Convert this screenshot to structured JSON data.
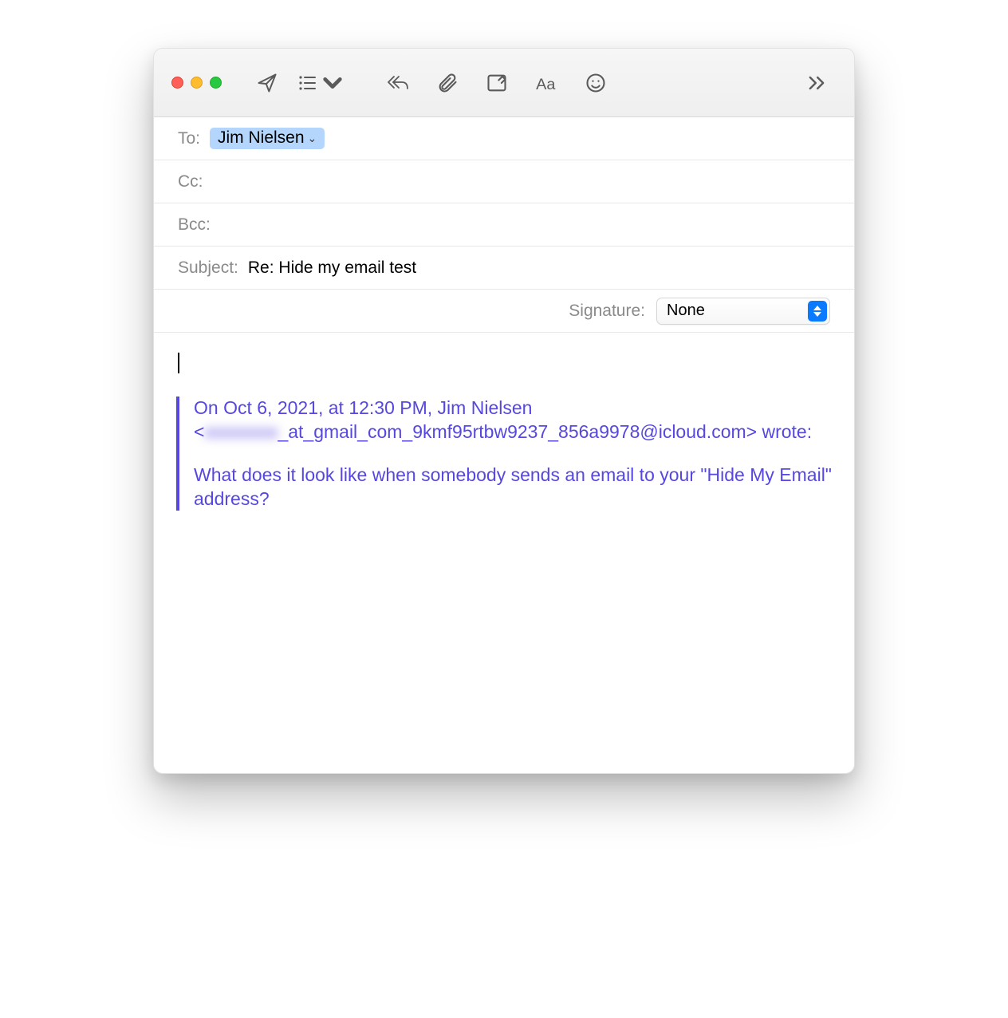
{
  "compose": {
    "to_label": "To:",
    "cc_label": "Cc:",
    "bcc_label": "Bcc:",
    "subject_label": "Subject:",
    "subject_value": "Re: Hide my email test",
    "recipient": "Jim Nielsen",
    "signature_label": "Signature:",
    "signature_value": "None"
  },
  "quoted": {
    "line1_prefix": "On Oct 6, 2021, at 12:30 PM, Jim Nielsen <",
    "hidden_user": "xxxxxxxx",
    "line1_suffix": "_at_gmail_com_9kmf95rtbw9237_856a9978@icloud.com> wrote:",
    "body": "What does it look like when somebody sends an email to your \"Hide My Email\" address?"
  }
}
